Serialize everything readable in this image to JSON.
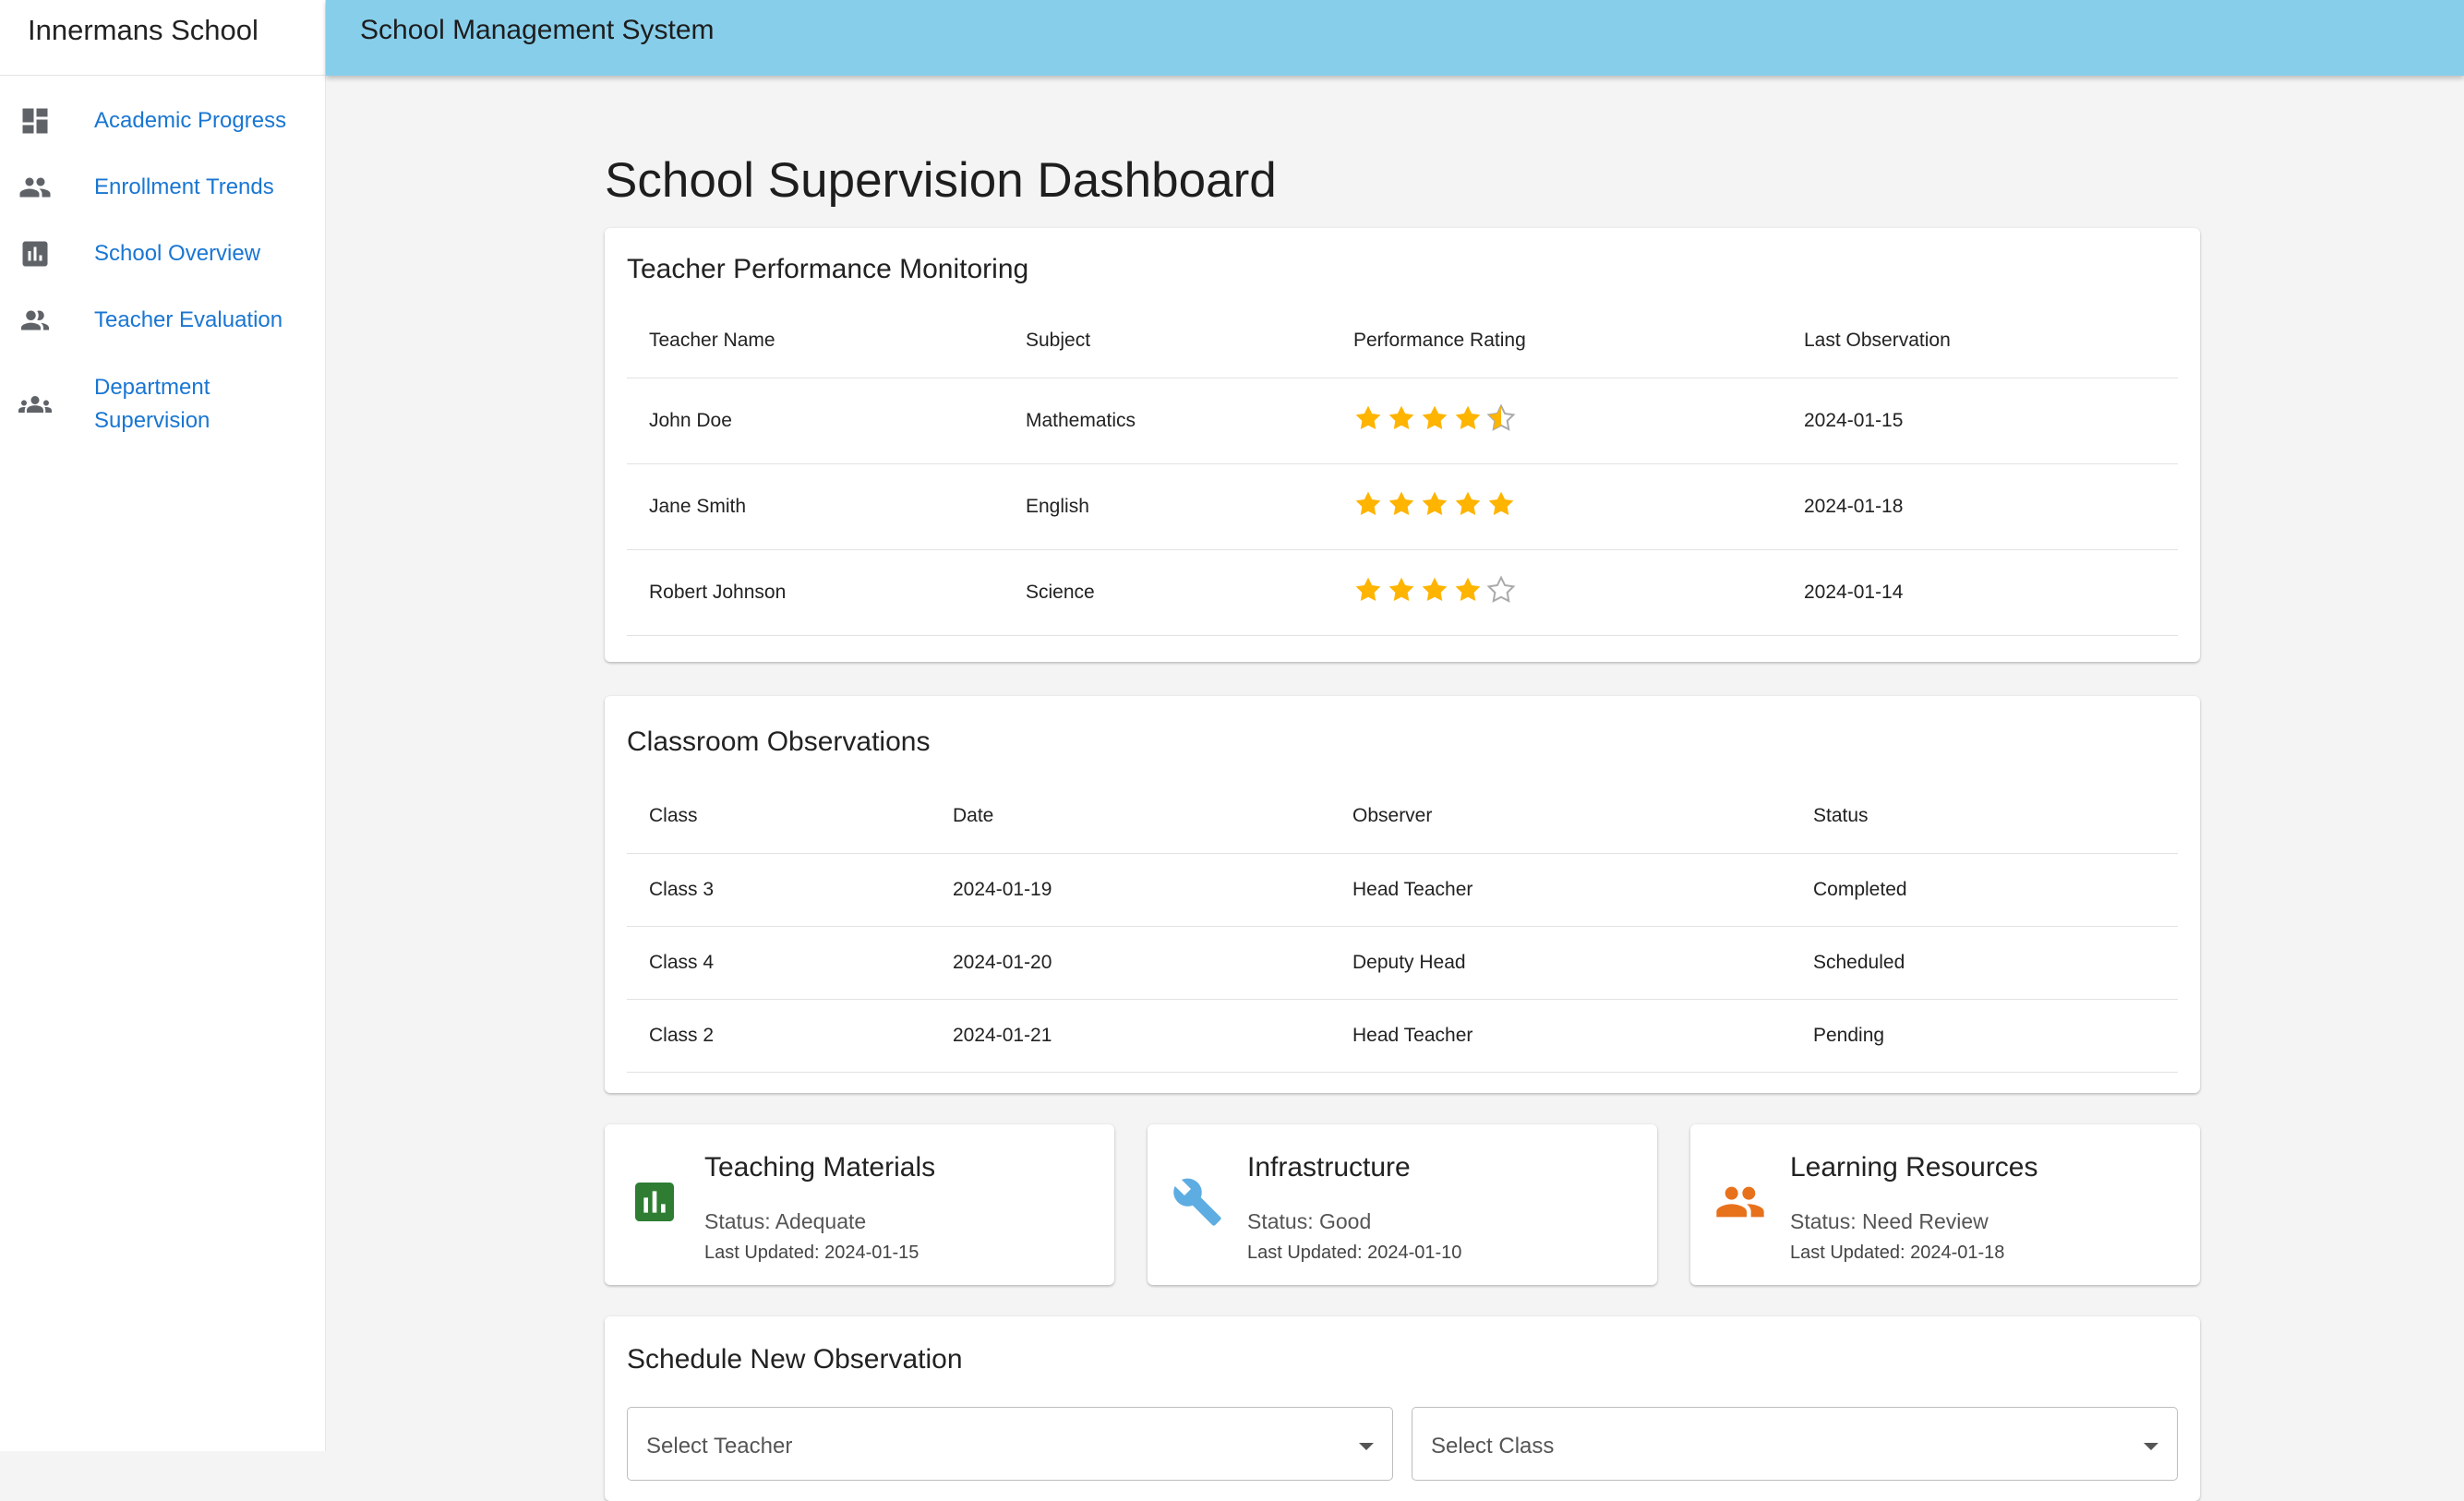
{
  "drawer": {
    "title": "Innermans School",
    "items": [
      {
        "label": "Academic Progress",
        "icon": "dashboard-icon"
      },
      {
        "label": "Enrollment Trends",
        "icon": "people-icon"
      },
      {
        "label": "School Overview",
        "icon": "bar-chart-icon"
      },
      {
        "label": "Teacher Evaluation",
        "icon": "person-group-icon"
      },
      {
        "label": "Department Supervision",
        "label_line1": "Department",
        "label_line2": "Supervision",
        "icon": "groups-icon"
      }
    ]
  },
  "appbar": {
    "title": "School Management System"
  },
  "page": {
    "title": "School Supervision Dashboard"
  },
  "performance": {
    "title": "Teacher Performance Monitoring",
    "columns": [
      "Teacher Name",
      "Subject",
      "Performance Rating",
      "Last Observation"
    ],
    "rows": [
      {
        "name": "John Doe",
        "subject": "Mathematics",
        "rating": 4.5,
        "last": "2024-01-15"
      },
      {
        "name": "Jane Smith",
        "subject": "English",
        "rating": 5,
        "last": "2024-01-18"
      },
      {
        "name": "Robert Johnson",
        "subject": "Science",
        "rating": 4,
        "last": "2024-01-14"
      }
    ]
  },
  "observations": {
    "title": "Classroom Observations",
    "columns": [
      "Class",
      "Date",
      "Observer",
      "Status"
    ],
    "rows": [
      {
        "class": "Class 3",
        "date": "2024-01-19",
        "observer": "Head Teacher",
        "status": "Completed"
      },
      {
        "class": "Class 4",
        "date": "2024-01-20",
        "observer": "Deputy Head",
        "status": "Scheduled"
      },
      {
        "class": "Class 2",
        "date": "2024-01-21",
        "observer": "Head Teacher",
        "status": "Pending"
      }
    ]
  },
  "resources": [
    {
      "name": "Teaching Materials",
      "status": "Status: Adequate",
      "updated": "Last Updated: 2024-01-15",
      "icon": "bar-chart-icon",
      "color": "#2e7d32"
    },
    {
      "name": "Infrastructure",
      "status": "Status: Good",
      "updated": "Last Updated: 2024-01-10",
      "icon": "wrench-icon",
      "color": "#5dade2"
    },
    {
      "name": "Learning Resources",
      "status": "Status: Need Review",
      "updated": "Last Updated: 2024-01-18",
      "icon": "people-icon",
      "color": "#e8711c"
    }
  ],
  "schedule": {
    "title": "Schedule New Observation",
    "teacher_select": "Select Teacher",
    "class_select": "Select Class"
  },
  "colors": {
    "appbar": "#87ceeb",
    "link": "#1976d2",
    "star": "#ffb400"
  }
}
